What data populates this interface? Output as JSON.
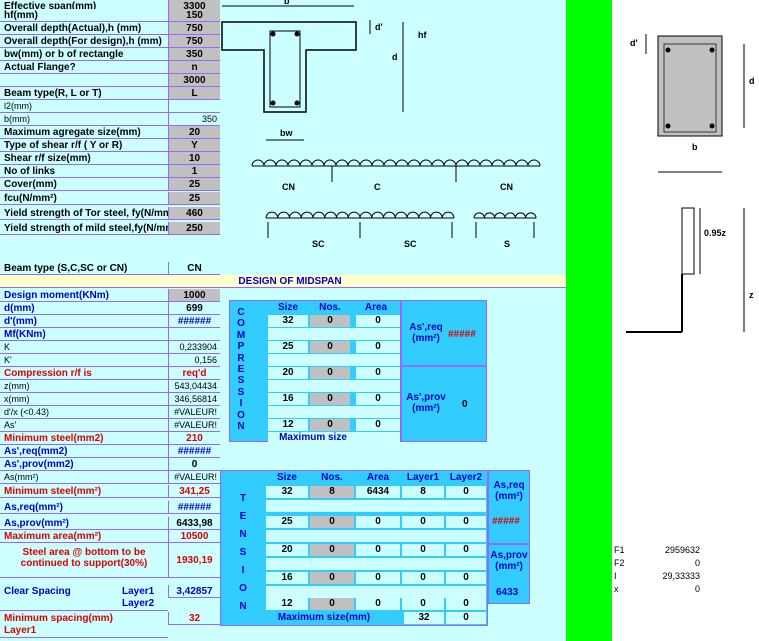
{
  "inputs": [
    {
      "label": "Effective span(mm)",
      "value": "3300"
    },
    {
      "label": "hf(mm)",
      "value": "150"
    },
    {
      "label": "Overall depth(Actual),h (mm)",
      "value": "750"
    },
    {
      "label": "Overall depth(For design),h (mm)",
      "value": "750"
    },
    {
      "label": "bw(mm) or b of rectangle",
      "value": "350"
    },
    {
      "label": "Actual Flange?",
      "value": "n"
    },
    {
      "label": "",
      "value": "3000"
    },
    {
      "label": "Beam type(R, L or T)",
      "value": "L"
    },
    {
      "label": "l2(mm)",
      "value": ""
    },
    {
      "label": "b(mm)",
      "value": "350"
    },
    {
      "label": "Maximum agregate size(mm)",
      "value": "20"
    },
    {
      "label": "Type of shear r/f ( Y or R)",
      "value": "Y"
    },
    {
      "label": "Shear r/f size(mm)",
      "value": "10"
    },
    {
      "label": "No of links",
      "value": "1"
    },
    {
      "label": "Cover(mm)",
      "value": "25"
    },
    {
      "label": "fcu(N/mm²)",
      "value": "25"
    },
    {
      "label": "Yield strength of Tor steel, fy(N/mm²)",
      "value": "460"
    },
    {
      "label": "Yield strength of mild steel,fy(N/mm²)",
      "value": "250"
    }
  ],
  "beam_type_sel": {
    "label": "Beam type (S,C,SC or CN)",
    "value": "CN"
  },
  "section_title": "DESIGN OF MIDSPAN",
  "midspan": [
    {
      "label": "Design moment(KNm)",
      "value": "1000"
    },
    {
      "label": "d(mm)",
      "value": "699"
    },
    {
      "label": "d'(mm)",
      "value": "######"
    },
    {
      "label": "Mf(KNm)",
      "value": ""
    },
    {
      "label": "K",
      "value": "0,233904"
    },
    {
      "label": "K'",
      "value": "0,156"
    },
    {
      "label": "Compression r/f is",
      "value": "req'd"
    },
    {
      "label": "z(mm)",
      "value": "543,04434"
    },
    {
      "label": "x(mm)",
      "value": "346,56814"
    },
    {
      "label": "d'/x (<0.43)",
      "value": "#VALEUR!"
    },
    {
      "label": "As'",
      "value": "#VALEUR!"
    },
    {
      "label": "Minimum steel(mm2)",
      "value": "210"
    },
    {
      "label": "As',req(mm2)",
      "value": "######"
    },
    {
      "label": "As',prov(mm2)",
      "value": "0"
    },
    {
      "label": "As(mm²)",
      "value": "#VALEUR!"
    },
    {
      "label": "Minimum steel(mm²)",
      "value": "341,25"
    },
    {
      "label": "As,req(mm²)",
      "value": "######"
    },
    {
      "label": "As,prov(mm²)",
      "value": "6433,98"
    },
    {
      "label": "Maximum area(mm²)",
      "value": "10500"
    }
  ],
  "continued": {
    "label": "Steel area @ bottom to be continued to support(30%)",
    "value": "1930,19"
  },
  "clear_spacing": {
    "label": "Clear Spacing",
    "l1": "Layer1",
    "l2": "Layer2",
    "value": "3,42857"
  },
  "min_spacing": {
    "label": "Minimum spacing(mm)",
    "layer": "Layer1",
    "value": "32"
  },
  "compression": {
    "side": "COMPRESSION",
    "headers": [
      "Size",
      "Nos.",
      "Area"
    ],
    "rows": [
      [
        "32",
        "0",
        "0"
      ],
      [
        "25",
        "0",
        "0"
      ],
      [
        "20",
        "0",
        "0"
      ],
      [
        "16",
        "0",
        "0"
      ],
      [
        "12",
        "0",
        "0"
      ]
    ],
    "max_label": "Maximum size",
    "req_label": "As',req (mm²)",
    "req_value": "#####",
    "prov_label": "As',prov (mm²)",
    "prov_value": "0"
  },
  "tension": {
    "side": "TENSION",
    "headers": [
      "Size",
      "Nos.",
      "Area",
      "Layer1",
      "Layer2"
    ],
    "rows": [
      [
        "32",
        "8",
        "6434",
        "8",
        "0"
      ],
      [
        "25",
        "0",
        "0",
        "0",
        "0"
      ],
      [
        "20",
        "0",
        "0",
        "0",
        "0"
      ],
      [
        "16",
        "0",
        "0",
        "0",
        "0"
      ],
      [
        "12",
        "0",
        "0",
        "0",
        "0"
      ]
    ],
    "max_label": "Maximum size(mm)",
    "max_value": "32",
    "max_value2": "0",
    "req_label": "As,req (mm²)",
    "req_value": "#####",
    "prov_label": "As,prov (mm²)",
    "prov_value": "6433"
  },
  "diagram_labels": {
    "b": "b",
    "df": "d'",
    "hf": "hf",
    "d": "d",
    "bw": "bw",
    "CN": "CN",
    "C": "C",
    "SC": "SC",
    "S": "S",
    "z095": "0.95z",
    "z": "z"
  },
  "side_values": [
    {
      "k": "F1",
      "v": "2959632"
    },
    {
      "k": "F2",
      "v": "0"
    },
    {
      "k": "I",
      "v": "29,33333"
    },
    {
      "k": "x",
      "v": "0"
    }
  ],
  "colors": {
    "bg": "#ccffff",
    "grey": "#c0c0c0",
    "green": "#00ff00",
    "header_blue": "#33ccff",
    "title_yellow": "#ffffcc",
    "red": "#dd0000",
    "blue": "#0000cc"
  }
}
